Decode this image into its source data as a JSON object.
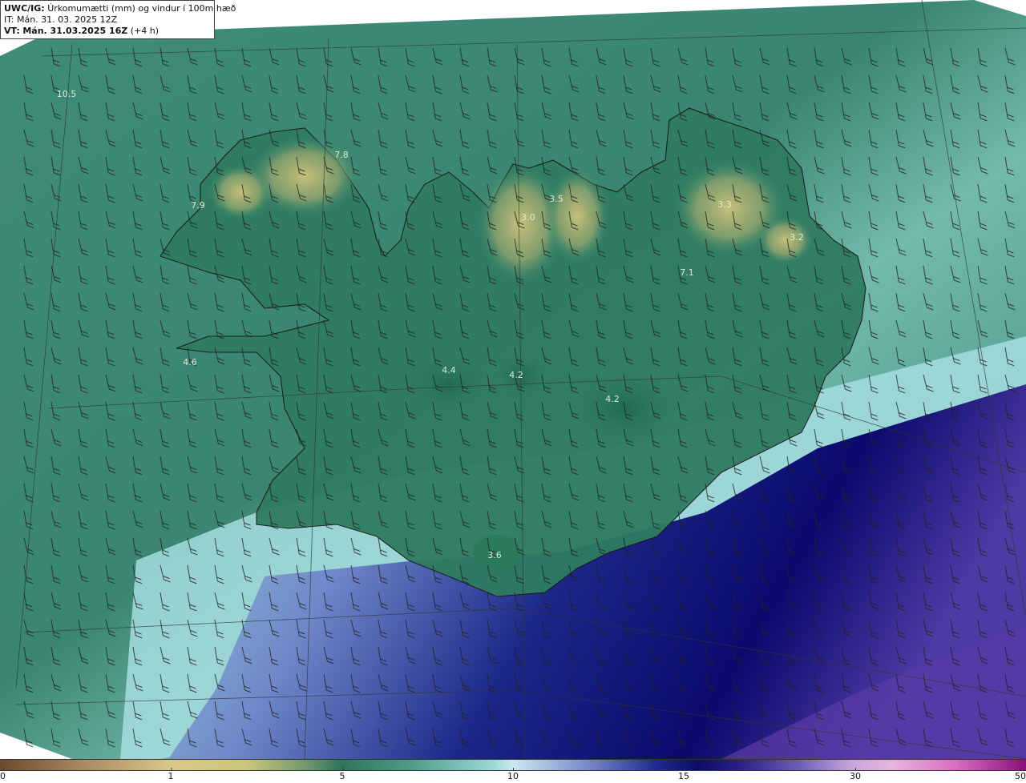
{
  "header": {
    "model": "UWC/IG:",
    "title": "Úrkomumætti (mm) og vindur í 100m hæð",
    "it_line": "IT: Mán. 31. 03. 2025 12Z",
    "vt_prefix": "VT:",
    "vt_value": "Mán. 31.03.2025 16Z",
    "vt_offset": "(+4 h)"
  },
  "map": {
    "ocean_color": "#3e8f78",
    "land_outline_color": "#1a1a1a",
    "value_labels": [
      "10.5",
      "7.8",
      "7.9",
      "3.5",
      "3.0",
      "3.3",
      "3.2",
      "7.1",
      "4.6",
      "4.4",
      "4.2",
      "4.2",
      "3.6"
    ]
  },
  "colorbar": {
    "ticks": [
      "0",
      "1",
      "5",
      "10",
      "15",
      "30",
      "50"
    ]
  }
}
